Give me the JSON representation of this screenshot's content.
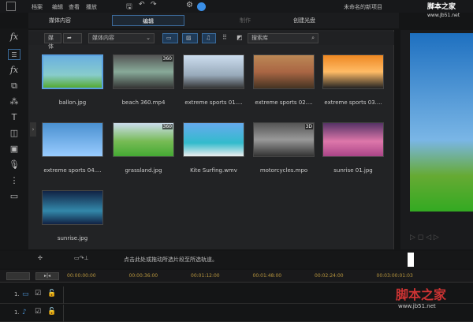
{
  "menu": [
    "档案",
    "编辑",
    "查看",
    "播放"
  ],
  "project_title": "未命名的新项目",
  "tabs": [
    "媒体内容",
    "编辑",
    "制作",
    "创建光盘"
  ],
  "toolbar": {
    "media_select": "媒体内容",
    "search_placeholder": "搜索库",
    "short_label": "媒体"
  },
  "media": [
    {
      "name": "ballon.jpg",
      "bg": "linear-gradient(#6ab0e0,#8cc 60%,#5a3)",
      "selected": true
    },
    {
      "name": "beach 360.mp4",
      "bg": "linear-gradient(#555,#8a9 50%,#333)",
      "badge": "360"
    },
    {
      "name": "extreme sports 01....",
      "bg": "linear-gradient(#cde,#9ab 60%,#333)"
    },
    {
      "name": "extreme sports 02....",
      "bg": "linear-gradient(#b85,#a64 50%,#432)"
    },
    {
      "name": "extreme sports 03....",
      "bg": "linear-gradient(#e82,#fb6 50%,#222)"
    },
    {
      "name": "extreme sports 04....",
      "bg": "linear-gradient(#4a90d0,#9cf)"
    },
    {
      "name": "grassland.jpg",
      "bg": "linear-gradient(#cde,#7b5 55%,#4a3)",
      "badge": "360"
    },
    {
      "name": "Kite Surfing.wmv",
      "bg": "linear-gradient(#6ae,#3bc 60%,#eee)"
    },
    {
      "name": "motorcycles.mpo",
      "bg": "linear-gradient(#555,#999 50%,#333)",
      "badge": "3D"
    },
    {
      "name": "sunrise 01.jpg",
      "bg": "linear-gradient(#536,#d7a 55%,#a48)"
    },
    {
      "name": "sunrise.jpg",
      "bg": "linear-gradient(#124,#38a 60%,#124)"
    }
  ],
  "timeline": {
    "hint": "点击此处或拖动所选片段至所选轨道。",
    "timecodes": [
      "00:00:00:00",
      "00:00:36:00",
      "00:01:12:00",
      "00:01:48:00",
      "00:02:24:00",
      "00:03:00:01:03"
    ],
    "tracks": [
      {
        "label": "1.",
        "icon": "video-track-icon"
      },
      {
        "label": "1.",
        "icon": "audio-track-icon"
      }
    ]
  },
  "watermark": {
    "top": "脚本之家",
    "top_url": "www.Jb51.net",
    "bottom": "脚本之家",
    "bottom_url": "www.jb51.net"
  },
  "colors": {
    "accent": "#3c6a9a",
    "timecode": "#b8963e"
  }
}
